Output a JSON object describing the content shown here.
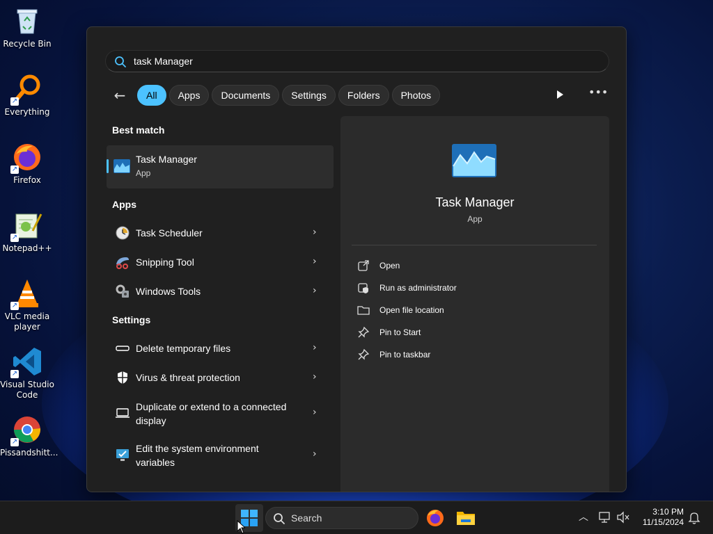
{
  "desktop": {
    "icons": [
      {
        "label": "Recycle Bin",
        "icon": "recycle-bin-icon"
      },
      {
        "label": "Everything",
        "icon": "everything-icon"
      },
      {
        "label": "Firefox",
        "icon": "firefox-icon"
      },
      {
        "label": "Notepad++",
        "icon": "notepad-plus-plus-icon"
      },
      {
        "label": "VLC media player",
        "icon": "vlc-icon"
      },
      {
        "label": "Visual Studio Code",
        "icon": "vscode-icon"
      },
      {
        "label": "Pissandshitt...",
        "icon": "chrome-icon"
      }
    ]
  },
  "start_menu": {
    "search": {
      "value": "task Manager"
    },
    "filters": [
      "All",
      "Apps",
      "Documents",
      "Settings",
      "Folders",
      "Photos"
    ],
    "active_filter": "All",
    "best_match_heading": "Best match",
    "best_match": {
      "title": "Task Manager",
      "subtitle": "App"
    },
    "apps_heading": "Apps",
    "apps": [
      {
        "label": "Task Scheduler",
        "icon": "task-scheduler-icon"
      },
      {
        "label": "Snipping Tool",
        "icon": "snipping-tool-icon"
      },
      {
        "label": "Windows Tools",
        "icon": "windows-tools-icon"
      }
    ],
    "settings_heading": "Settings",
    "settings": [
      {
        "label": "Delete temporary files",
        "icon": "storage-icon"
      },
      {
        "label": "Virus & threat protection",
        "icon": "shield-icon"
      },
      {
        "label": "Duplicate or extend to a connected display",
        "icon": "display-icon"
      },
      {
        "label": "Edit the system environment variables",
        "icon": "system-properties-icon"
      }
    ],
    "preview": {
      "title": "Task Manager",
      "subtitle": "App",
      "actions": [
        {
          "label": "Open",
          "icon": "open-external-icon"
        },
        {
          "label": "Run as administrator",
          "icon": "admin-shield-icon"
        },
        {
          "label": "Open file location",
          "icon": "folder-icon"
        },
        {
          "label": "Pin to Start",
          "icon": "pin-icon"
        },
        {
          "label": "Pin to taskbar",
          "icon": "pin-icon"
        }
      ]
    }
  },
  "taskbar": {
    "search_label": "Search",
    "time": "3:10 PM",
    "date": "11/15/2024"
  },
  "colors": {
    "accent": "#4cc2ff",
    "panel": "#202020",
    "preview_panel": "#2b2b2b"
  }
}
